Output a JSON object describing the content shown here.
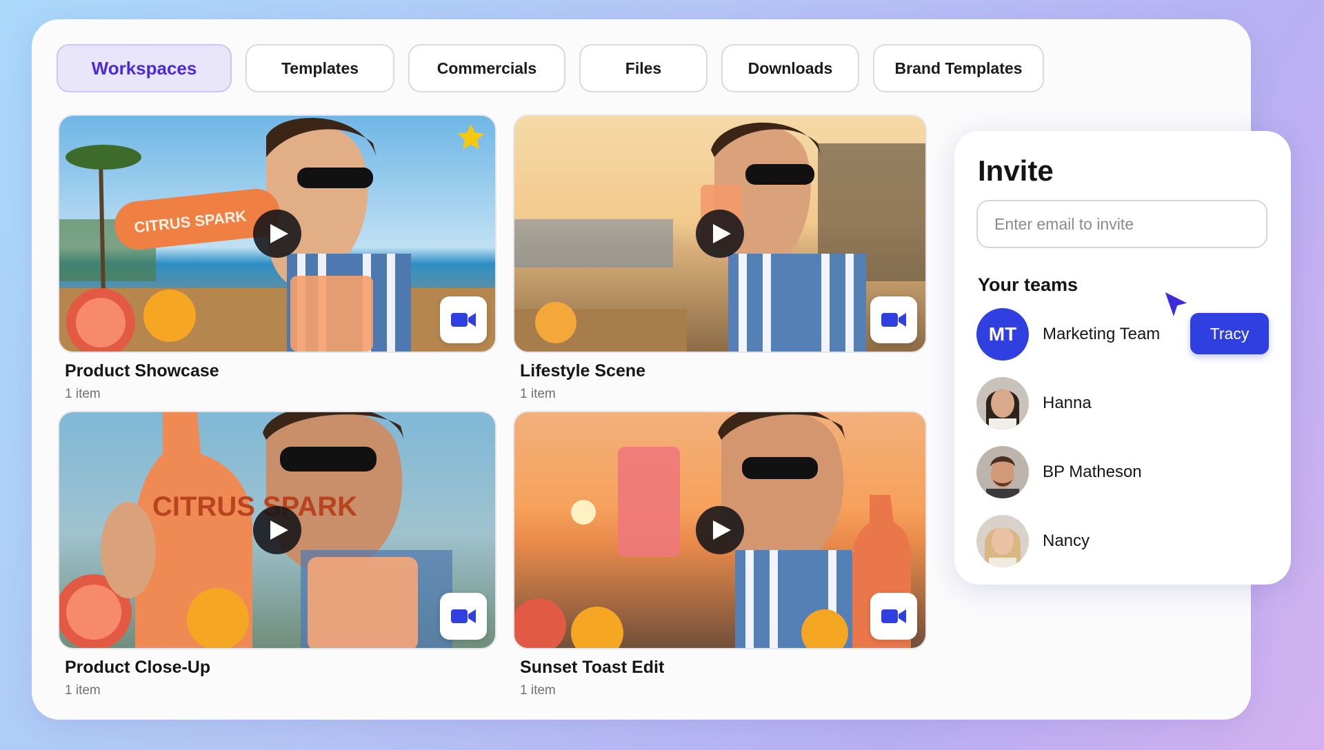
{
  "tabs": [
    {
      "label": "Workspaces",
      "active": true
    },
    {
      "label": "Templates"
    },
    {
      "label": "Commercials"
    },
    {
      "label": "Files"
    },
    {
      "label": "Downloads"
    },
    {
      "label": "Brand Templates"
    }
  ],
  "workspaces": [
    {
      "title": "Product Showcase",
      "count": "1 item",
      "starred": true,
      "photo_label": "CITRUS SPARK"
    },
    {
      "title": "Lifestyle Scene",
      "count": "1 item",
      "starred": false
    },
    {
      "title": "Product Close-Up",
      "count": "1 item",
      "starred": false,
      "photo_label": "CITRUS SPARK"
    },
    {
      "title": "Sunset Toast Edit",
      "count": "1 item",
      "starred": false
    }
  ],
  "invite": {
    "title": "Invite",
    "email_placeholder": "Enter email to invite",
    "teams_label": "Your teams",
    "members": [
      {
        "name": "Marketing Team",
        "initials": "MT"
      },
      {
        "name": "Hanna"
      },
      {
        "name": "BP Matheson"
      },
      {
        "name": "Nancy"
      }
    ],
    "cursor_tag": "Tracy"
  },
  "colors": {
    "accent": "#2f3fe0",
    "tab_active_bg": "#e9e5fb",
    "tab_active_text": "#4a2bd6",
    "star": "#f6c90e"
  },
  "icons": [
    "play-icon",
    "video-camera-icon",
    "star-icon",
    "cursor-arrow-icon"
  ]
}
